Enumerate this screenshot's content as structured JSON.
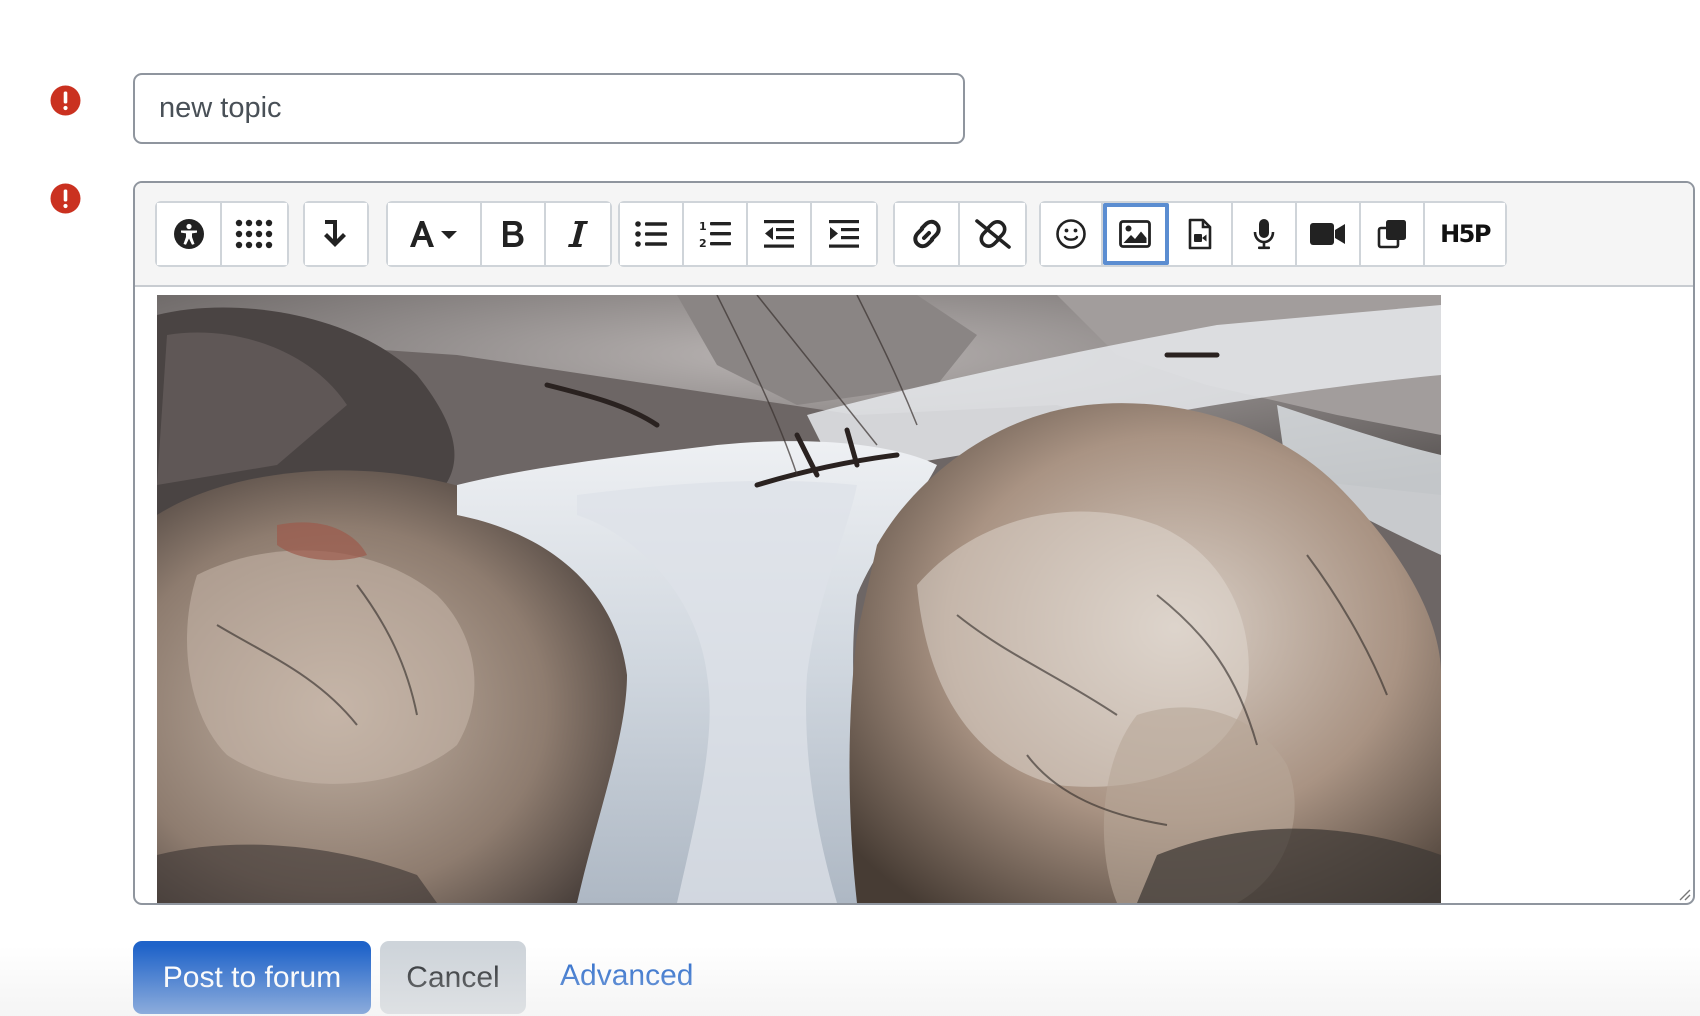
{
  "form": {
    "subject": {
      "value": "new topic",
      "placeholder": ""
    },
    "required_icon": "exclamation-circle-icon",
    "colors": {
      "required": "#ca3120",
      "primary": "#1f63c9",
      "secondary": "#ced4da",
      "active_outline": "#5b8dd1"
    }
  },
  "toolbar": {
    "groups": [
      [
        "accessibility-checker-icon",
        "show-more-buttons-icon"
      ],
      [
        "screenreader-helper-icon"
      ],
      [
        "font-color-icon",
        "bold-icon",
        "italic-icon"
      ],
      [
        "unordered-list-icon",
        "ordered-list-icon",
        "outdent-icon",
        "indent-icon"
      ],
      [
        "link-icon",
        "unlink-icon"
      ],
      [
        "emoji-icon",
        "insert-image-icon",
        "insert-media-icon",
        "record-audio-icon",
        "record-video-icon",
        "manage-files-icon",
        "h5p-icon"
      ]
    ],
    "active": "insert-image-icon",
    "h5p_label": "H5P"
  },
  "editor": {
    "content": "waterfall-photo"
  },
  "actions": {
    "post_label": "Post to forum",
    "cancel_label": "Cancel",
    "advanced_label": "Advanced"
  }
}
